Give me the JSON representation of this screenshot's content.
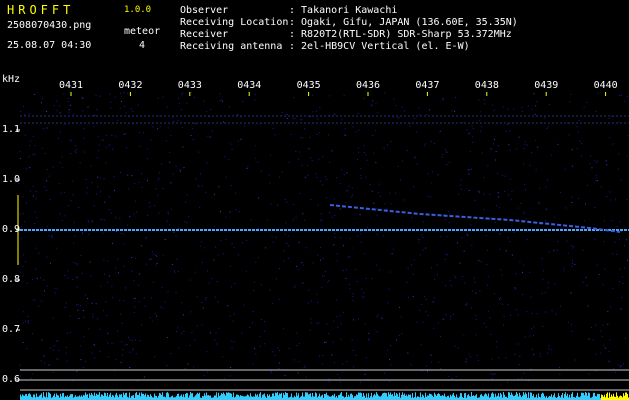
{
  "header": {
    "app_name": "HROFFT",
    "version": "1.0.0",
    "filename": "2508070430.png",
    "datetime": "25.08.07 04:30",
    "meteor_label": "meteor",
    "meteor_count": "4",
    "observer_label": "Observer",
    "observer_value": ": Takanori Kawachi",
    "location_label": "Receiving Location",
    "location_value": ": Ogaki, Gifu, JAPAN (136.60E, 35.35N)",
    "receiver_label": "Receiver",
    "receiver_value": ": R820T2(RTL-SDR) SDR-Sharp 53.372MHz",
    "antenna_label": "Receiving antenna",
    "antenna_value": ": 2el-HB9CV Vertical (el. E-W)"
  },
  "axis": {
    "y_unit": "kHz",
    "time_ticks": [
      "0431",
      "0432",
      "0433",
      "0434",
      "0435",
      "0436",
      "0437",
      "0438",
      "0439",
      "0440"
    ],
    "freq_ticks": [
      "1.1",
      "1.0",
      "0.9",
      "0.8",
      "0.7",
      "0.6"
    ]
  },
  "colors": {
    "background": "#000000",
    "noise": "#1a1aa0",
    "signal": "#4fa8ff",
    "tick": "#ffff00",
    "level_bar": "#33ccff"
  }
}
